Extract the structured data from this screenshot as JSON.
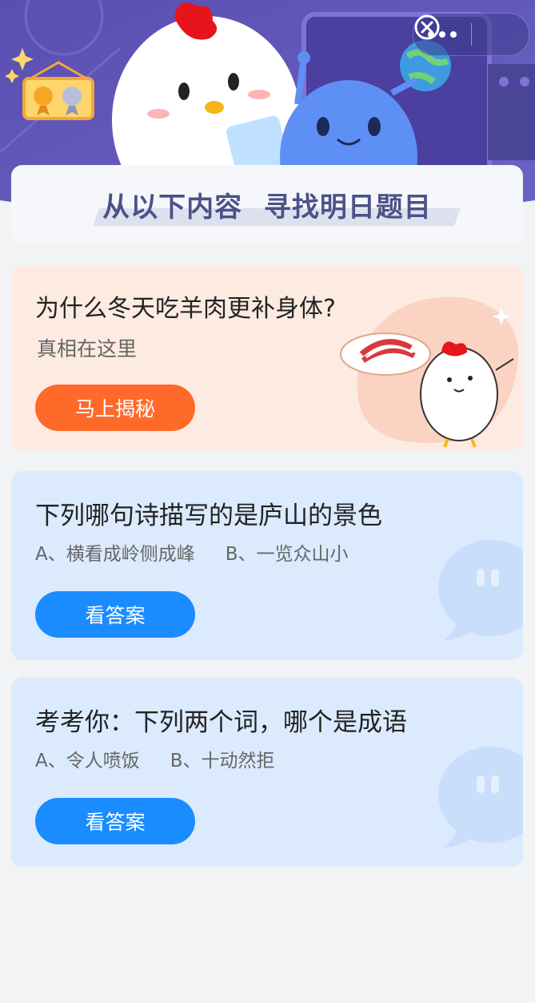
{
  "header": {
    "banner_title": "从以下内容 寻找明日题目"
  },
  "capsule": {
    "more_icon": "more-dots-icon",
    "close_icon": "close-circle-icon"
  },
  "cards": [
    {
      "question": "为什么冬天吃羊肉更补身体?",
      "subtitle": "真相在这里",
      "button": "马上揭秘"
    },
    {
      "question": "下列哪句诗描写的是庐山的景色",
      "options": [
        "A、横看成岭侧成峰",
        "B、一览众山小"
      ],
      "button": "看答案"
    },
    {
      "question": "考考你：下列两个词，哪个是成语",
      "options": [
        "A、令人喷饭",
        "B、十动然拒"
      ],
      "button": "看答案"
    }
  ],
  "colors": {
    "hero_purple": "#5f58b8",
    "orange_button": "#ff6a2b",
    "blue_button": "#1a8cff",
    "card_peach": "#fdebe1",
    "card_blue": "#dbeafd"
  }
}
